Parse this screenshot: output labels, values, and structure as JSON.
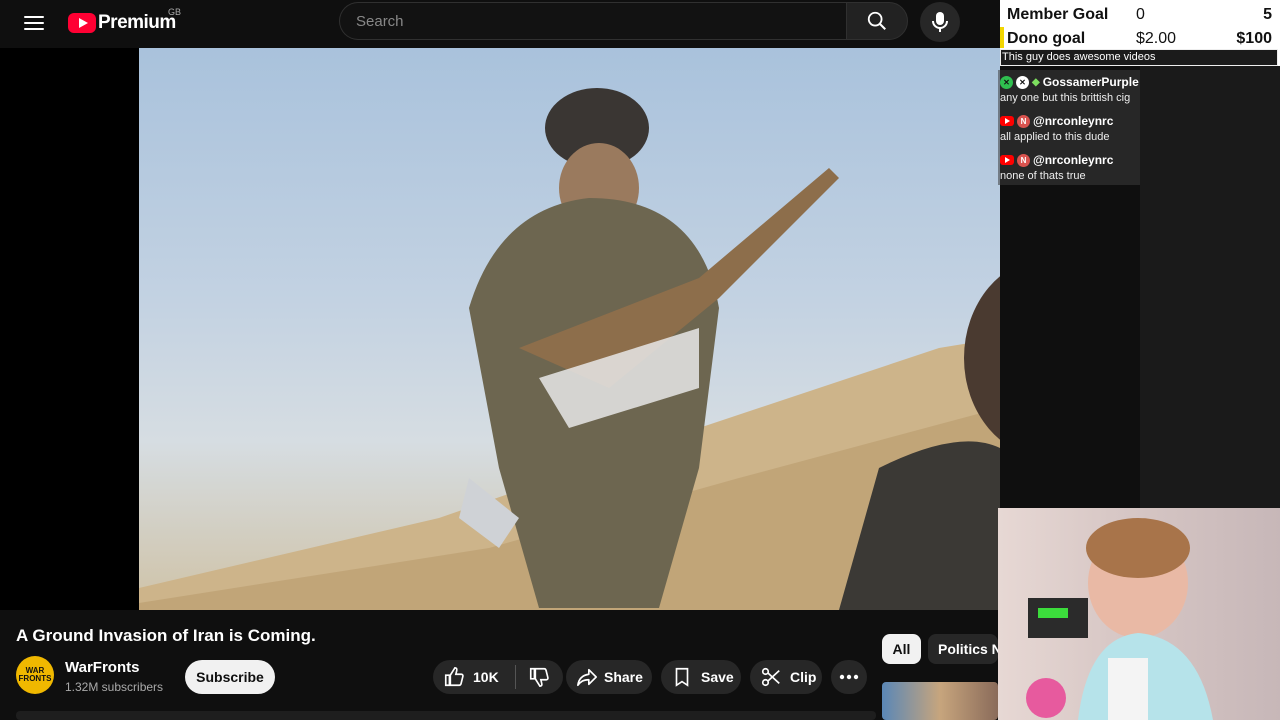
{
  "header": {
    "logo_text": "Premium",
    "region": "GB",
    "search_placeholder": "Search"
  },
  "video": {
    "title": "A Ground Invasion of Iran is Coming.",
    "channel": {
      "name": "WarFronts",
      "subscribers": "1.32M subscribers",
      "avatar_text": "WAR FRONTS"
    },
    "subscribe_label": "Subscribe",
    "actions": {
      "like_count": "10K",
      "share_label": "Share",
      "save_label": "Save",
      "clip_label": "Clip"
    }
  },
  "chips": {
    "all_label": "All",
    "politics_label": "Politics N"
  },
  "overlay": {
    "member_goal": {
      "label": "Member Goal",
      "current": "0",
      "target": "5"
    },
    "dono_goal": {
      "label": "Dono goal",
      "current": "$2.00",
      "target": "$100"
    },
    "goal_message": "This guy does awesome videos",
    "chat": [
      {
        "user": "GossamerPurple",
        "text": "any one but this brittish cig"
      },
      {
        "user": "@nrconleynrc",
        "text": "all applied to this dude"
      },
      {
        "user": "@nrconleynrc",
        "text": "none of thats true"
      }
    ]
  },
  "colors": {
    "youtube_red": "#ff0033",
    "background": "#0f0f0f",
    "goal_bar": "#f2d600"
  }
}
